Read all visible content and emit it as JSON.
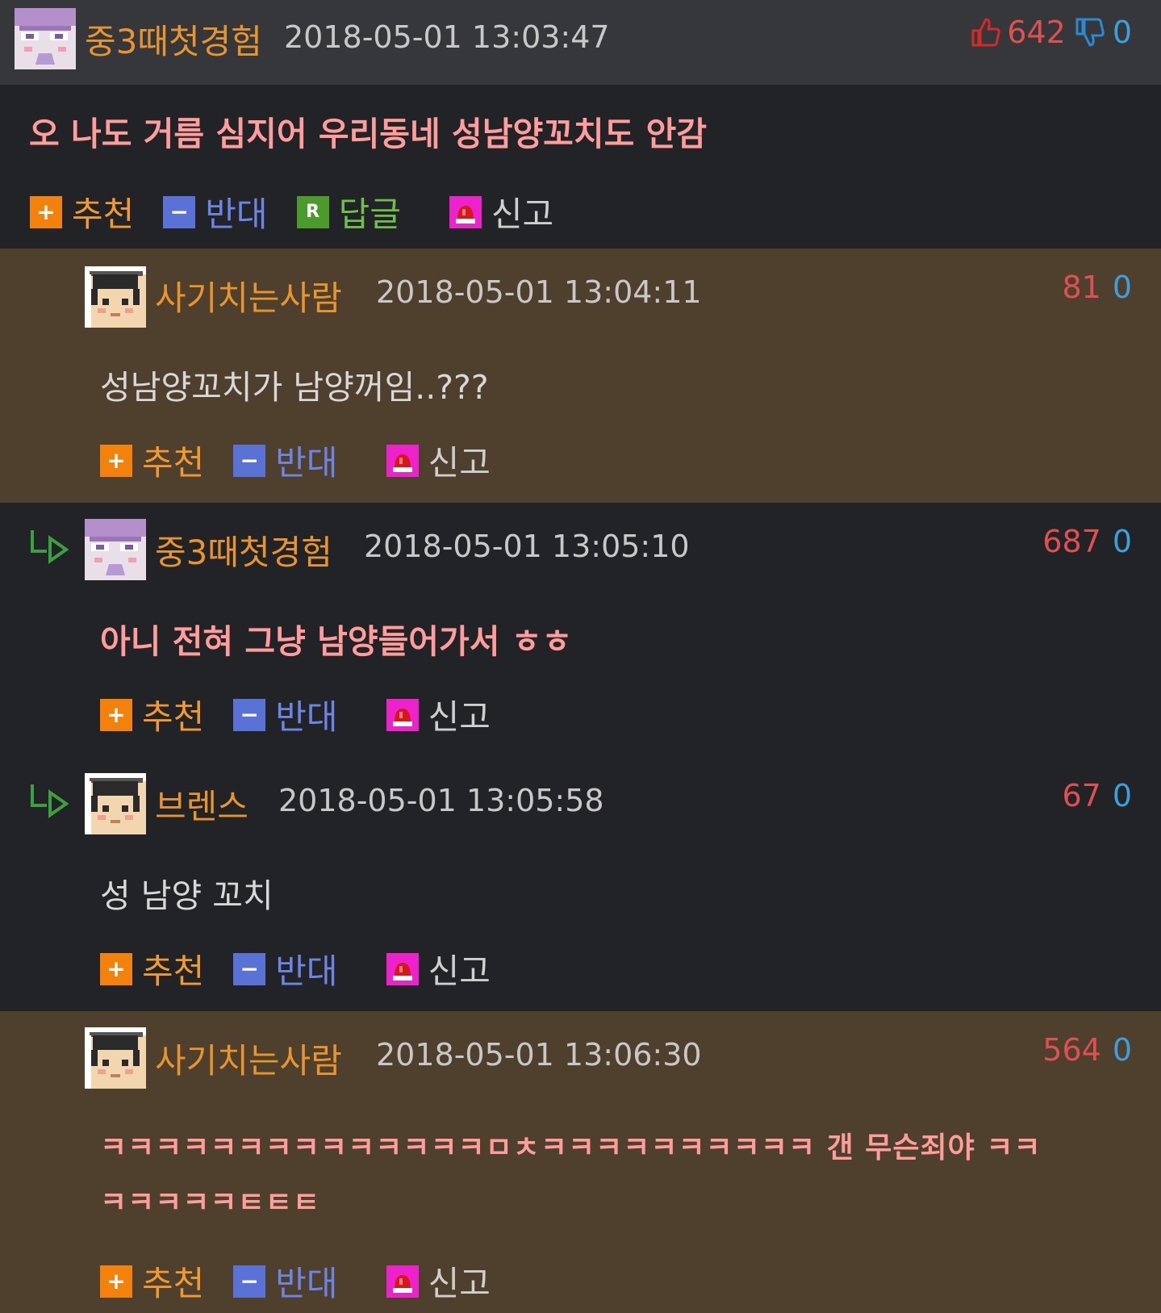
{
  "comments": [
    {
      "username": "중3때첫경험",
      "timestamp": "2018-05-01 13:03:47",
      "upvotes": "642",
      "downvotes": "0",
      "text": "오 나도 거름 심지어 우리동네 성남양꼬치도 안감",
      "text_lines": []
    },
    {
      "username": "사기치는사람",
      "timestamp": "2018-05-01 13:04:11",
      "upvotes": "81",
      "downvotes": "0",
      "text": "성남양꼬치가 남양꺼임..???"
    },
    {
      "username": "중3때첫경험",
      "timestamp": "2018-05-01 13:05:10",
      "upvotes": "687",
      "downvotes": "0",
      "text": "아니 전혀 그냥 남양들어가서 ㅎㅎ"
    },
    {
      "username": "브렌스",
      "timestamp": "2018-05-01 13:05:58",
      "upvotes": "67",
      "downvotes": "0",
      "text": "성 남양 꼬치"
    },
    {
      "username": "사기치는사람",
      "timestamp": "2018-05-01 13:06:30",
      "upvotes": "564",
      "downvotes": "0",
      "text_line1": "ㅋㅋㅋㅋㅋㅋㅋㅋㅋㅋㅋㅋㅋㅋㅁㅊㅋㅋㅋㅋㅋㅋㅋㅋㅋㅋ 갠 무슨죄야 ㅋㅋ",
      "text_line2": "ㅋㅋㅋㅋㅋㅌㅌㅌ"
    }
  ],
  "actions": {
    "recommend": "추천",
    "oppose": "반대",
    "reply": "답글",
    "report": "신고",
    "plus_glyph": "+",
    "minus_glyph": "−",
    "reply_glyph": "R"
  },
  "icons": {
    "avatar_a": "purple-eyes-avatar-icon",
    "avatar_b": "graduation-cap-avatar-icon",
    "thumbs_up": "thumbs-up-icon",
    "thumbs_down": "thumbs-down-icon",
    "reply_arrow": "reply-arrow-icon",
    "siren": "siren-icon"
  },
  "colors": {
    "background": "#222326",
    "header_bar": "#36373a",
    "highlight_bg": "#4f3f2d",
    "username": "#e8952e",
    "upvote": "#e05050",
    "downvote": "#3aa0e0",
    "pink_text": "#ff9c9c"
  }
}
